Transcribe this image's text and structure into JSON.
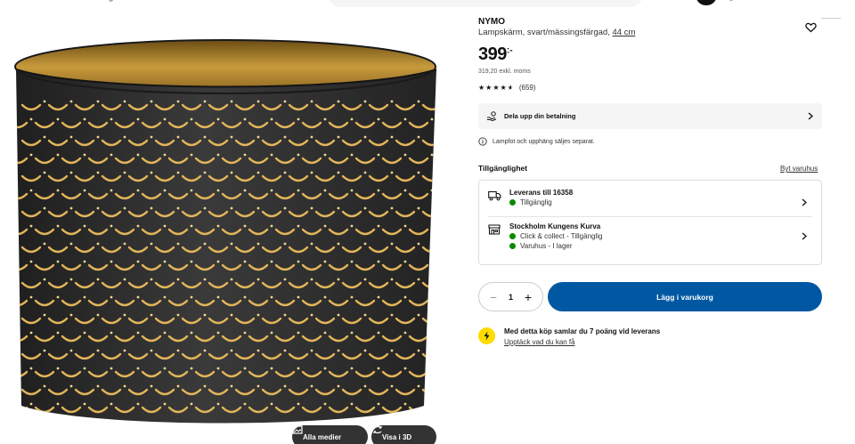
{
  "product": {
    "brand": "NYMO",
    "description": "Lampskärm, svart/mässingsfärgad,",
    "size": "44 cm",
    "price": "399",
    "currency_suffix": ":-",
    "price_excl": "319,20 exkl. moms",
    "rating_stars": 4.5,
    "reviews": "(659)"
  },
  "gallery": {
    "all_media": "Alla medier",
    "view_3d": "Visa i 3D"
  },
  "payment": {
    "label": "Dela upp din betalning"
  },
  "info_note": "Lampfot och upphäng säljes separat.",
  "availability": {
    "title": "Tillgänglighet",
    "change_store": "Byt varuhus",
    "delivery": {
      "title": "Leverans till 16358",
      "status": "Tillgänglig"
    },
    "store": {
      "title": "Stockholm Kungens Kurva",
      "click_collect": "Click & collect - Tillgänglig",
      "in_store": "Varuhus - I lager"
    }
  },
  "purchase": {
    "quantity": "1",
    "minus": "−",
    "plus": "+",
    "add_to_cart": "Lägg i varukorg"
  },
  "loyalty": {
    "text": "Med detta köp samlar du 7 poäng vid leverans",
    "link": "Upptäck vad du kan få"
  },
  "colors": {
    "primary": "#0058a3",
    "available": "#0a8a00",
    "loyalty": "#ffdb00"
  }
}
